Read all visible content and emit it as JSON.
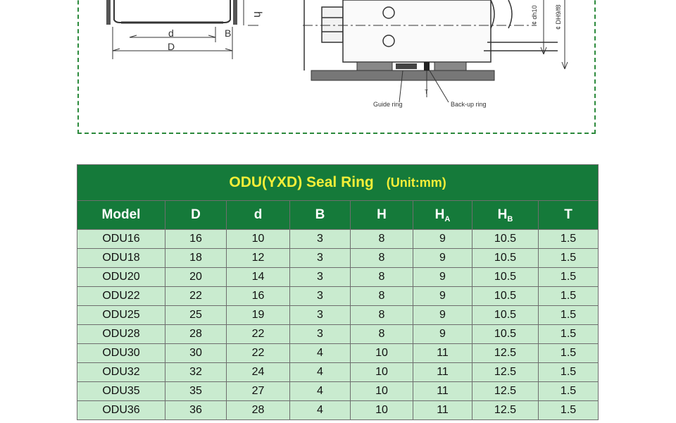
{
  "drawing": {
    "label_h": "h",
    "label_d": "d",
    "label_B": "B",
    "label_D": "D",
    "label_dh": "¢ dh10",
    "label_DH": "¢ DH9/f8",
    "label_T": "T",
    "guide_ring": "Guide ring",
    "backup_ring": "Back-up ring"
  },
  "table": {
    "title": "ODU(YXD) Seal Ring",
    "unit": "(Unit:mm)",
    "headers": {
      "model": "Model",
      "D": "D",
      "d": "d",
      "B": "B",
      "H": "H",
      "HA_main": "H",
      "HA_sub": "A",
      "HB_main": "H",
      "HB_sub": "B",
      "T": "T"
    },
    "rows": [
      [
        "ODU16",
        "16",
        "10",
        "3",
        "8",
        "9",
        "10.5",
        "1.5"
      ],
      [
        "ODU18",
        "18",
        "12",
        "3",
        "8",
        "9",
        "10.5",
        "1.5"
      ],
      [
        "ODU20",
        "20",
        "14",
        "3",
        "8",
        "9",
        "10.5",
        "1.5"
      ],
      [
        "ODU22",
        "22",
        "16",
        "3",
        "8",
        "9",
        "10.5",
        "1.5"
      ],
      [
        "ODU25",
        "25",
        "19",
        "3",
        "8",
        "9",
        "10.5",
        "1.5"
      ],
      [
        "ODU28",
        "28",
        "22",
        "3",
        "8",
        "9",
        "10.5",
        "1.5"
      ],
      [
        "ODU30",
        "30",
        "22",
        "4",
        "10",
        "11",
        "12.5",
        "1.5"
      ],
      [
        "ODU32",
        "32",
        "24",
        "4",
        "10",
        "11",
        "12.5",
        "1.5"
      ],
      [
        "ODU35",
        "35",
        "27",
        "4",
        "10",
        "11",
        "12.5",
        "1.5"
      ],
      [
        "ODU36",
        "36",
        "28",
        "4",
        "10",
        "11",
        "12.5",
        "1.5"
      ]
    ]
  }
}
